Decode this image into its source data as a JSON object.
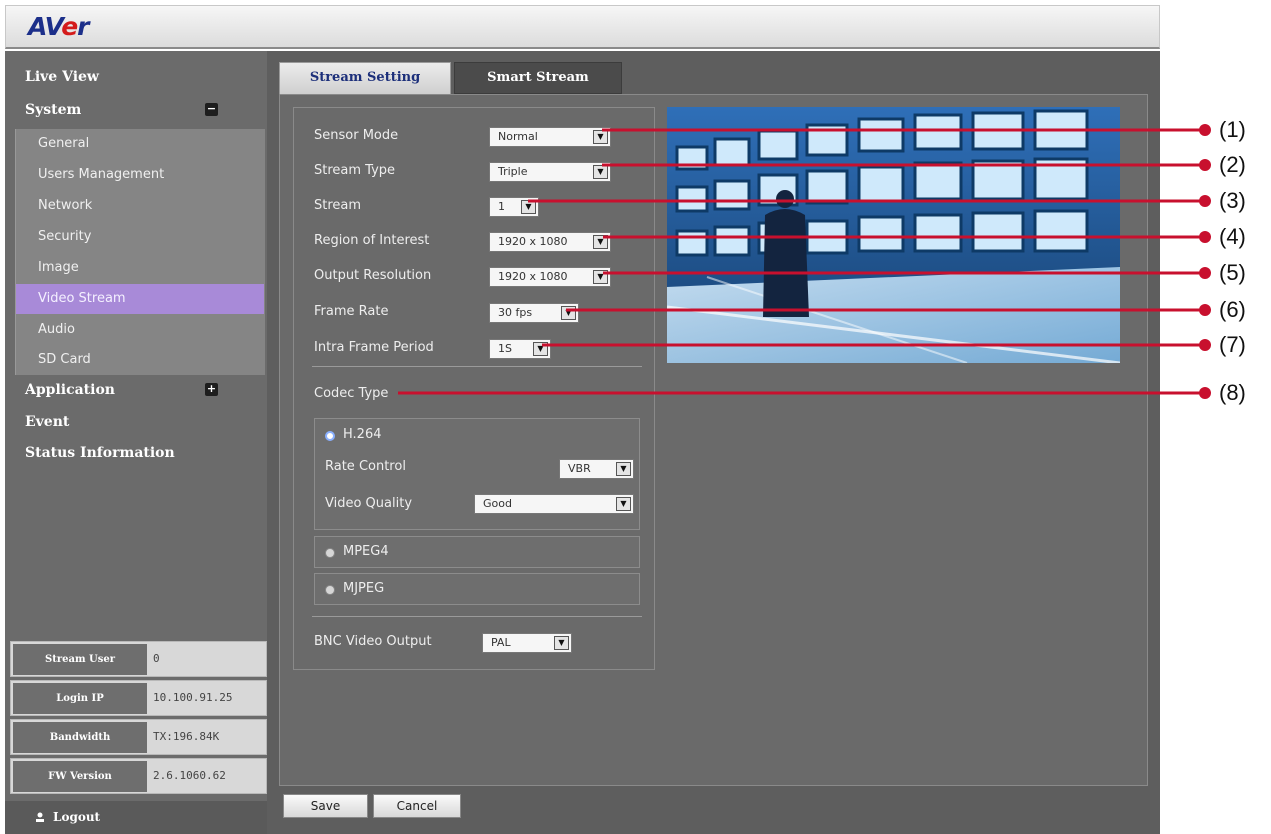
{
  "brand": {
    "logo_prefix": "AV",
    "logo_accent": "e",
    "logo_suffix": "r"
  },
  "sidebar": {
    "live_view": "Live View",
    "system": "System",
    "system_toggle": "−",
    "submenu": [
      "General",
      "Users Management",
      "Network",
      "Security",
      "Image",
      "Video Stream",
      "Audio",
      "SD Card"
    ],
    "active_index": 5,
    "application": "Application",
    "application_toggle": "+",
    "event": "Event",
    "status_information": "Status Information"
  },
  "info": [
    {
      "label": "Stream User",
      "value": "0"
    },
    {
      "label": "Login IP",
      "value": "10.100.91.25"
    },
    {
      "label": "Bandwidth",
      "value": "TX:196.84K"
    },
    {
      "label": "FW Version",
      "value": "2.6.1060.62"
    }
  ],
  "logout_label": "Logout",
  "tabs": {
    "stream_setting": "Stream Setting",
    "smart_stream": "Smart Stream"
  },
  "settings": {
    "sensor_mode": {
      "label": "Sensor Mode",
      "value": "Normal"
    },
    "stream_type": {
      "label": "Stream Type",
      "value": "Triple"
    },
    "stream": {
      "label": "Stream",
      "value": "1"
    },
    "region_of_interest": {
      "label": "Region of Interest",
      "value": "1920 x 1080"
    },
    "output_resolution": {
      "label": "Output Resolution",
      "value": "1920 x 1080"
    },
    "frame_rate": {
      "label": "Frame Rate",
      "value": "30 fps"
    },
    "intra_frame_period": {
      "label": "Intra Frame Period",
      "value": "1S"
    },
    "codec_type_label": "Codec Type",
    "h264": {
      "label": "H.264",
      "selected": true
    },
    "rate_control": {
      "label": "Rate Control",
      "value": "VBR"
    },
    "video_quality": {
      "label": "Video Quality",
      "value": "Good"
    },
    "mpeg4": {
      "label": "MPEG4",
      "selected": false
    },
    "mjpeg": {
      "label": "MJPEG",
      "selected": false
    },
    "bnc_video_output": {
      "label": "BNC Video Output",
      "value": "PAL"
    }
  },
  "buttons": {
    "save": "Save",
    "cancel": "Cancel"
  },
  "callouts": [
    "(1)",
    "(2)",
    "(3)",
    "(4)",
    "(5)",
    "(6)",
    "(7)",
    "(8)"
  ],
  "colors": {
    "callout_line": "#c8102e",
    "active_menu": "#a88ad8",
    "logo_blue": "#1c2f8a",
    "logo_red": "#d41b1b"
  }
}
